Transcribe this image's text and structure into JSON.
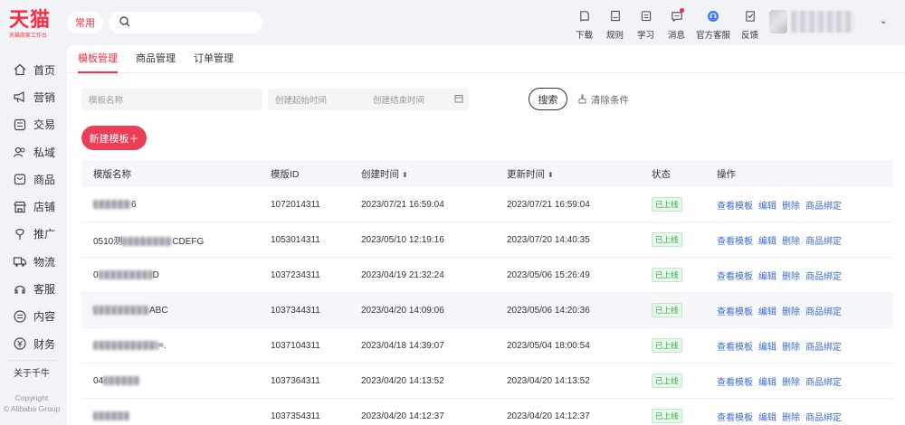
{
  "logo": {
    "main": "天猫",
    "sub": "天猫商家工作台"
  },
  "sidebar": {
    "items": [
      {
        "label": "首页",
        "icon": "home-icon"
      },
      {
        "label": "营销",
        "icon": "megaphone-icon"
      },
      {
        "label": "交易",
        "icon": "trade-icon"
      },
      {
        "label": "私域",
        "icon": "users-icon"
      },
      {
        "label": "商品",
        "icon": "goods-icon"
      },
      {
        "label": "店铺",
        "icon": "store-icon"
      },
      {
        "label": "推广",
        "icon": "promotion-icon"
      },
      {
        "label": "物流",
        "icon": "truck-icon"
      },
      {
        "label": "客服",
        "icon": "headset-icon"
      },
      {
        "label": "内容",
        "icon": "content-icon"
      },
      {
        "label": "财务",
        "icon": "finance-icon"
      }
    ],
    "about": "关于千牛",
    "copyright_line1": "Copyright",
    "copyright_line2": "© Alibaba Group"
  },
  "topbar": {
    "quick": "常用",
    "search_placeholder": "",
    "actions": [
      {
        "label": "下载",
        "icon": "download-icon"
      },
      {
        "label": "规则",
        "icon": "rules-icon"
      },
      {
        "label": "学习",
        "icon": "learn-icon"
      },
      {
        "label": "消息",
        "icon": "message-icon",
        "dot": true
      },
      {
        "label": "官方客服",
        "icon": "official-service-icon"
      },
      {
        "label": "反馈",
        "icon": "feedback-icon"
      }
    ]
  },
  "tabs": [
    "模板管理",
    "商品管理",
    "订单管理"
  ],
  "filters": {
    "name_placeholder": "模板名称",
    "start_placeholder": "创建起始时间",
    "end_placeholder": "创建结束时间",
    "search_button": "搜索",
    "clear_button": "清除条件",
    "new_button": "新建模板＋"
  },
  "table": {
    "headers": {
      "name": "模版名称",
      "id": "模版ID",
      "created": "创建时间",
      "updated": "更新时间",
      "status": "状态",
      "ops": "操作"
    },
    "sort_glyph": "⬍",
    "ops": [
      "查看模板",
      "编辑",
      "删除",
      "商品绑定"
    ],
    "rows": [
      {
        "name_visible": "",
        "name_suffix": "6",
        "id": "1072014311",
        "created": "2023/07/21 16:59:04",
        "updated": "2023/07/21 16:59:04",
        "status": "已上线"
      },
      {
        "name_visible": "0510测",
        "name_suffix": "CDEFG",
        "id": "1053014311",
        "created": "2023/05/10 12:19:16",
        "updated": "2023/07/20 14:40:35",
        "status": "已上线"
      },
      {
        "name_visible": "0",
        "name_suffix": "D",
        "id": "1037234311",
        "created": "2023/04/19 21:32:24",
        "updated": "2023/05/06 15:26:49",
        "status": "已上线"
      },
      {
        "name_visible": "",
        "name_suffix": "ABC",
        "id": "1037344311",
        "created": "2023/04/20 14:09:06",
        "updated": "2023/05/06 14:20:36",
        "status": "已上线"
      },
      {
        "name_visible": "",
        "name_suffix": "=.",
        "id": "1037104311",
        "created": "2023/04/18 14:39:07",
        "updated": "2023/05/04 18:00:54",
        "status": "已上线"
      },
      {
        "name_visible": "04",
        "name_suffix": "",
        "id": "1037364311",
        "created": "2023/04/20 14:13:52",
        "updated": "2023/04/20 14:13:52",
        "status": "已上线"
      },
      {
        "name_visible": "",
        "name_suffix": "",
        "id": "1037354311",
        "created": "2023/04/20 14:12:37",
        "updated": "2023/04/20 14:12:37",
        "status": "已上线"
      }
    ]
  },
  "colors": {
    "brand_red": "#ff2b3f",
    "link_blue": "#3d6bd6",
    "status_green": "#2fae4a"
  }
}
